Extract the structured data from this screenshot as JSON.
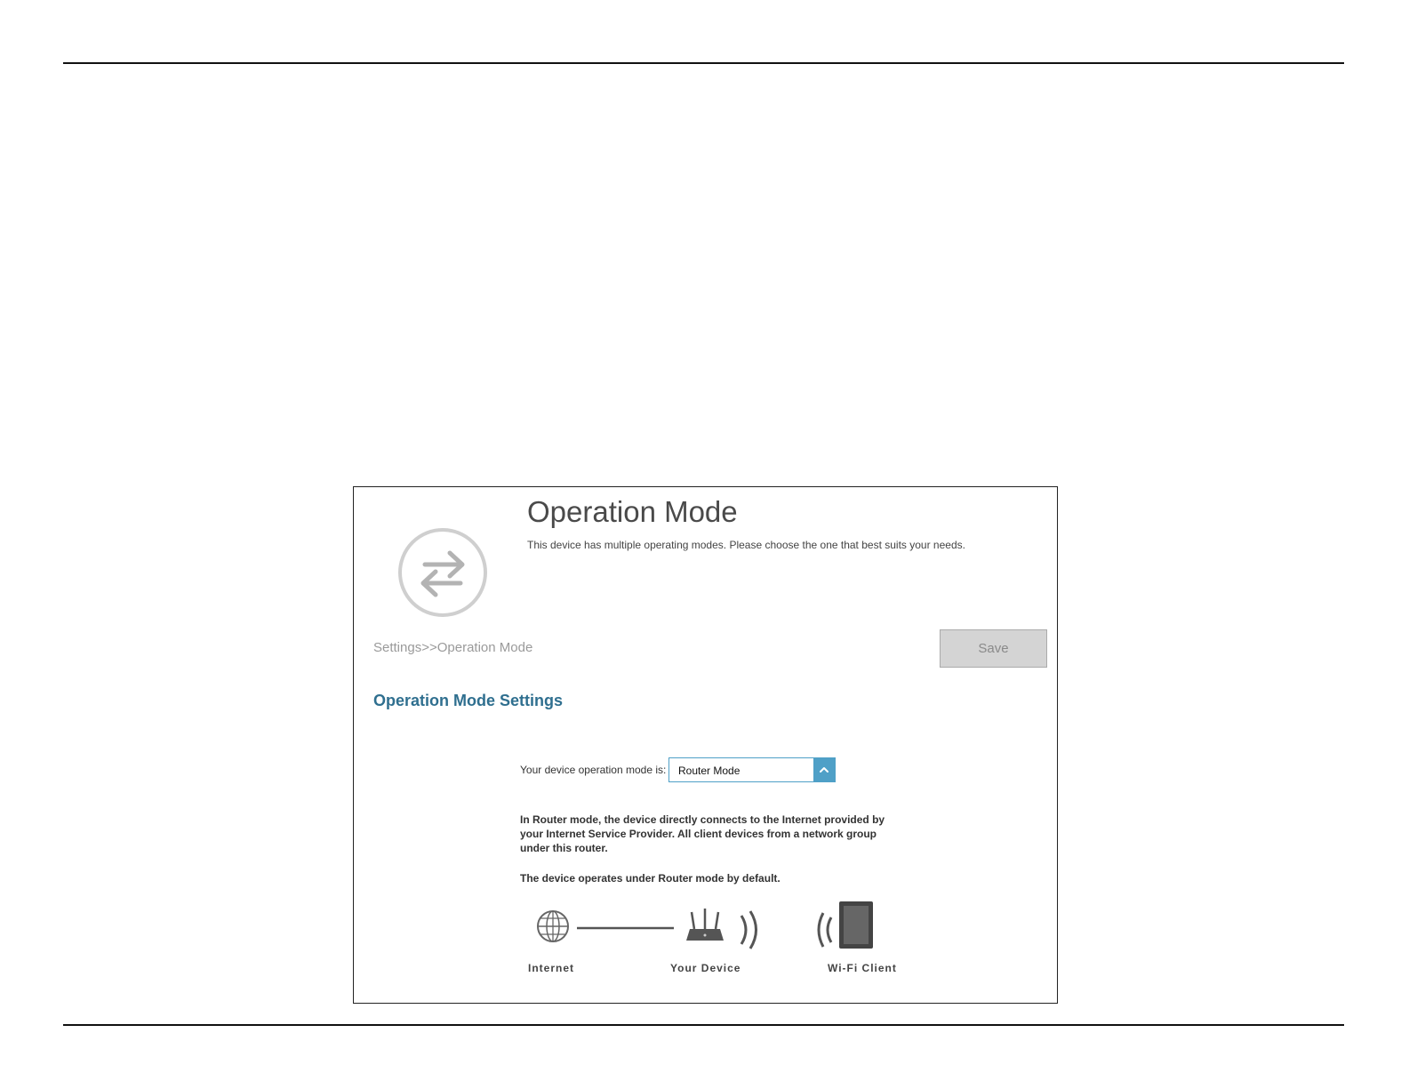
{
  "page": {
    "title": "Operation Mode",
    "description": "This device has multiple operating modes. Please choose the one that best suits your needs.",
    "breadcrumb": "Settings>>Operation Mode",
    "save_label": "Save",
    "section_title": "Operation Mode Settings"
  },
  "mode": {
    "label": "Your device operation mode is:",
    "selected": "Router Mode"
  },
  "explanation": {
    "text": "In Router mode, the device directly connects to the Internet provided by your Internet Service Provider. All client devices from a network group under this router.",
    "default_note": "The device operates under Router mode by default."
  },
  "diagram": {
    "internet_label": "Internet",
    "device_label": "Your Device",
    "client_label": "Wi-Fi Client"
  },
  "icons": {
    "mode": "swap-arrows-icon",
    "select_arrow": "chevron-up-icon",
    "internet": "globe-icon",
    "device": "router-icon",
    "client": "tablet-icon"
  },
  "colors": {
    "accent": "#4fa0c7",
    "section_title": "#2f6f8f"
  }
}
